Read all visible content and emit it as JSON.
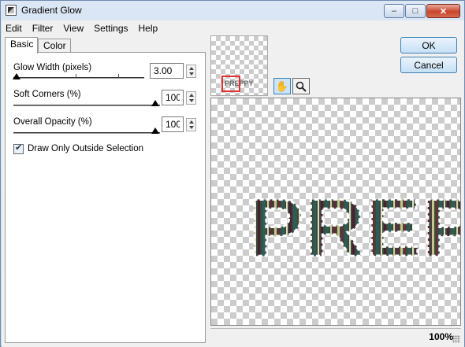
{
  "window": {
    "title": "Gradient Glow"
  },
  "menu": [
    "Edit",
    "Filter",
    "View",
    "Settings",
    "Help"
  ],
  "tabs": {
    "basic": "Basic",
    "color": "Color"
  },
  "controls": {
    "glow_width": {
      "label": "Glow Width (pixels)",
      "value": "3.00"
    },
    "soft_corners": {
      "label": "Soft Corners (%)",
      "value": "100"
    },
    "overall_opacity": {
      "label": "Overall Opacity (%)",
      "value": "100"
    },
    "draw_outside": {
      "label": "Draw Only Outside Selection",
      "checked": true
    }
  },
  "buttons": {
    "ok": "OK",
    "cancel": "Cancel"
  },
  "preview": {
    "thumb_text": "PREPPY",
    "canvas_text": "PREP"
  },
  "status": {
    "zoom": "100%"
  },
  "icons": [
    "app-icon",
    "minimize-icon",
    "maximize-icon",
    "close-icon",
    "hand-icon",
    "magnifier-icon"
  ]
}
